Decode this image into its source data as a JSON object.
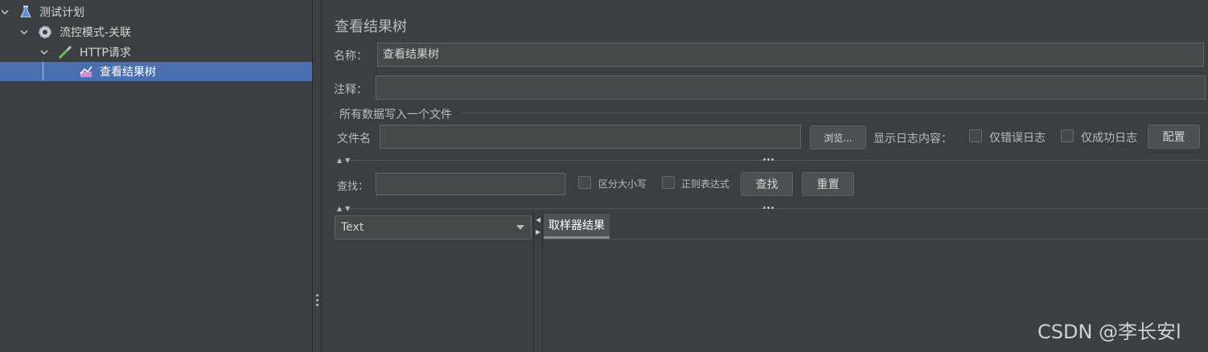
{
  "tree": {
    "items": [
      {
        "label": "测试计划",
        "icon": "flask-icon"
      },
      {
        "label": "流控模式-关联",
        "icon": "gear-icon"
      },
      {
        "label": "HTTP请求",
        "icon": "pipette-icon"
      },
      {
        "label": "查看结果树",
        "icon": "chart-icon"
      }
    ]
  },
  "panel": {
    "title": "查看结果树",
    "name_label": "名称：",
    "name_value": "查看结果树",
    "comment_label": "注释：",
    "comment_value": "",
    "file_group_title": "所有数据写入一个文件",
    "filename_label": "文件名",
    "filename_value": "",
    "browse_button": "浏览...",
    "log_display_label": "显示日志内容：",
    "errors_only_label": "仅错误日志",
    "success_only_label": "仅成功日志",
    "configure_button": "配置",
    "search_label": "查找：",
    "search_value": "",
    "case_sensitive_label": "区分大小写",
    "regex_label": "正则表达式",
    "find_button": "查找",
    "reset_button": "重置",
    "renderer_select": "Text",
    "result_tab": "取样器结果"
  },
  "watermark": "CSDN @李长安l",
  "colors": {
    "background": "#3c3f41",
    "selection": "#4b6eaf",
    "field_bg": "#45494a",
    "text": "#bbbbbb"
  }
}
